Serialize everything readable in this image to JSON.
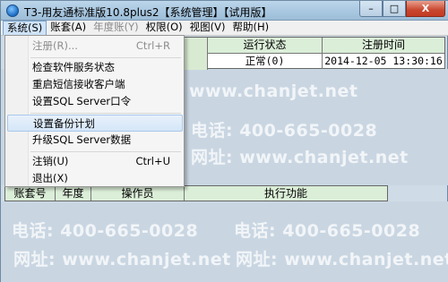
{
  "window": {
    "title": "T3-用友通标准版10.8plus2【系统管理】【试用版】",
    "buttons": {
      "minimize": "–",
      "maximize": "□",
      "close": "X"
    }
  },
  "menubar": [
    {
      "label": "系统(S)",
      "state": "active"
    },
    {
      "label": "账套(A)",
      "state": "normal"
    },
    {
      "label": "年度账(Y)",
      "state": "disabled"
    },
    {
      "label": "权限(O)",
      "state": "normal"
    },
    {
      "label": "视图(V)",
      "state": "normal"
    },
    {
      "label": "帮助(H)",
      "state": "normal"
    }
  ],
  "system_menu": {
    "items": [
      {
        "label": "注册(R)...",
        "shortcut": "Ctrl+R",
        "disabled": true
      },
      {
        "label": "检查软件服务状态",
        "shortcut": ""
      },
      {
        "label": "重启短信接收客户端",
        "shortcut": ""
      },
      {
        "label": "设置SQL Server口令",
        "shortcut": ""
      },
      {
        "label": "设置备份计划",
        "shortcut": "",
        "highlighted": true
      },
      {
        "label": "升级SQL Server数据",
        "shortcut": ""
      },
      {
        "label": "注销(U)",
        "shortcut": "Ctrl+U"
      },
      {
        "label": "退出(X)",
        "shortcut": ""
      }
    ]
  },
  "server_table": {
    "columns": [
      "运行状态",
      "注册时间"
    ],
    "row": {
      "status": "正常(0)",
      "registered": "2014-12-05 13:30:16"
    }
  },
  "login_table": {
    "columns": [
      "账套号",
      "年度",
      "操作员",
      "执行功能"
    ]
  },
  "watermarks": {
    "phone": "电话: 400-665-0028",
    "site": "网址: www.chanjet.net",
    "site_url": "www.chanjet.net",
    "site_label": "网址: ",
    "phone_label": "电话:",
    "net_fragment": "njet.net"
  },
  "colors": {
    "header_bg": "#dbeed8",
    "panel_bg": "#c9d6e2",
    "menu_highlight": "#d5e6f8",
    "close_button": "#c8472f"
  }
}
